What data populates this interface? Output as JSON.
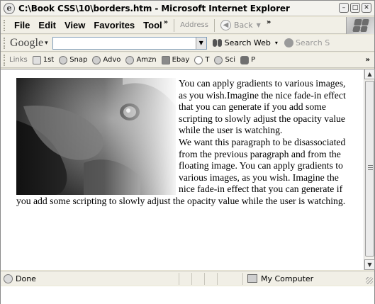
{
  "window": {
    "title": "C:\\Book CSS\\10\\borders.htm - Microsoft Internet Explorer",
    "min_glyph": "–",
    "max_glyph": "□",
    "close_glyph": "✕"
  },
  "menubar": {
    "items": [
      "File",
      "Edit",
      "View",
      "Favorites",
      "Tool"
    ],
    "overflow": "»",
    "address_label": "Address",
    "back_label": "Back",
    "back_arrow": "◀",
    "dropdown": "▼",
    "overflow2": "»"
  },
  "google_toolbar": {
    "logo": "Google",
    "dropdown": "▾",
    "search_value": "",
    "input_drop": "▼",
    "search_web_label": "Search Web",
    "search_web_drop": "▾",
    "search_site_label": "Search S"
  },
  "links_bar": {
    "label": "Links",
    "items": [
      "1st",
      "Snap",
      "Advo",
      "Amzn",
      "Ebay",
      "T",
      "Sci",
      "P"
    ],
    "overflow": "»"
  },
  "content": {
    "paragraph1": "You can apply gradients to various images, as you wish.Imagine the nice fade-in effect that you can generate if you add some scripting to slowly adjust the opacity value while the user is watching.",
    "paragraph2": "We want this paragraph to be disassociated from the previous paragraph and from the floating image. You can apply gradients to various images, as you wish. Imagine the nice fade-in effect that you can generate if you add some scripting to slowly adjust the opacity value while the user is watching.",
    "image_subject": "close-up of a dog's face fading to white on the right"
  },
  "scrollbar": {
    "up": "▲",
    "down": "▼"
  },
  "statusbar": {
    "status": "Done",
    "zone": "My Computer"
  }
}
